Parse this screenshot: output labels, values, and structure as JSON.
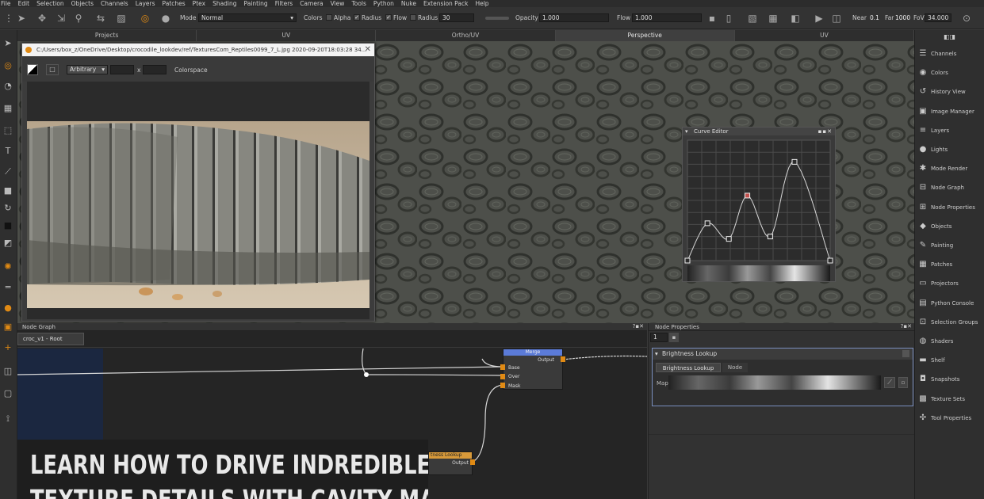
{
  "menu": [
    "File",
    "Edit",
    "Selection",
    "Objects",
    "Channels",
    "Layers",
    "Patches",
    "Ptex",
    "Shading",
    "Painting",
    "Filters",
    "Camera",
    "View",
    "Tools",
    "Python",
    "Nuke",
    "Extension Pack",
    "Help"
  ],
  "toolbar": {
    "mode_label": "Mode",
    "mode_value": "Normal",
    "colors_label": "Colors",
    "alpha_label": "Alpha",
    "radius_label": "Radius",
    "flow_label": "Flow",
    "radius2_label": "Radius",
    "radius_value": "30",
    "opacity_label": "Opacity",
    "opacity_value": "1.000",
    "flow2_label": "Flow",
    "flow_value": "1.000",
    "near_label": "Near",
    "near_value": "0.1",
    "far_label": "Far",
    "far_value": "1000",
    "fov_label": "FoV",
    "fov_value": "34.000"
  },
  "tabs": [
    {
      "label": "Projects",
      "active": false
    },
    {
      "label": "UV",
      "active": false
    },
    {
      "label": "Ortho/UV",
      "active": false
    },
    {
      "label": "Perspective",
      "active": true
    },
    {
      "label": "UV",
      "active": false
    }
  ],
  "image_window": {
    "title": "C:/Users/box_z/OneDrive/Desktop/crocodile_lookdev/ref/TexturesCom_Reptiles0099_7_L.jpg 2020-09-20T18:03:28 34...",
    "size_mode": "Arbitrary",
    "x_sep": "x",
    "colorspace_label": "Colorspace"
  },
  "curve_editor": {
    "title": "Curve Editor",
    "points": [
      [
        0,
        0
      ],
      [
        0.14,
        0.31
      ],
      [
        0.29,
        0.18
      ],
      [
        0.42,
        0.54
      ],
      [
        0.58,
        0.2
      ],
      [
        0.75,
        0.82
      ],
      [
        1,
        0
      ]
    ],
    "active_point_index": 3
  },
  "node_graph": {
    "panel_title": "Node Graph",
    "breadcrumb": "croc_v1 - Root",
    "merge_node": {
      "title": "Merge",
      "output": "Output",
      "inputs": [
        "Base",
        "Over",
        "Mask"
      ]
    },
    "lookup_node": {
      "title": "tness Lookup",
      "output": "Output"
    }
  },
  "node_properties": {
    "panel_title": "Node Properties",
    "counter": "1",
    "section_title": "Brightness Lookup",
    "tabs": [
      "Brightness Lookup",
      "Node"
    ],
    "map_label": "Map"
  },
  "right_panel": [
    {
      "label": "Channels",
      "icon": "channels-icon",
      "glyph": "☰"
    },
    {
      "label": "Colors",
      "icon": "palette-icon",
      "glyph": "◉"
    },
    {
      "label": "History View",
      "icon": "history-icon",
      "glyph": "↺"
    },
    {
      "label": "Image Manager",
      "icon": "image-icon",
      "glyph": "▣"
    },
    {
      "label": "Layers",
      "icon": "layers-icon",
      "glyph": "≡"
    },
    {
      "label": "Lights",
      "icon": "bulb-icon",
      "glyph": "●"
    },
    {
      "label": "Mode Render",
      "icon": "render-icon",
      "glyph": "✱"
    },
    {
      "label": "Node Graph",
      "icon": "node-graph-icon",
      "glyph": "⊟"
    },
    {
      "label": "Node Properties",
      "icon": "node-props-icon",
      "glyph": "⊞"
    },
    {
      "label": "Objects",
      "icon": "objects-icon",
      "glyph": "◆"
    },
    {
      "label": "Painting",
      "icon": "brush-icon",
      "glyph": "✎"
    },
    {
      "label": "Patches",
      "icon": "patches-icon",
      "glyph": "▦"
    },
    {
      "label": "Projectors",
      "icon": "projector-icon",
      "glyph": "▭"
    },
    {
      "label": "Python Console",
      "icon": "console-icon",
      "glyph": "▤"
    },
    {
      "label": "Selection Groups",
      "icon": "selection-icon",
      "glyph": "⊡"
    },
    {
      "label": "Shaders",
      "icon": "shaders-icon",
      "glyph": "◍"
    },
    {
      "label": "Shelf",
      "icon": "shelf-icon",
      "glyph": "▬"
    },
    {
      "label": "Snapshots",
      "icon": "camera-icon",
      "glyph": "◘"
    },
    {
      "label": "Texture Sets",
      "icon": "texture-sets-icon",
      "glyph": "▩"
    },
    {
      "label": "Tool Properties",
      "icon": "wrench-icon",
      "glyph": "✣"
    }
  ],
  "banner": {
    "line1": "LEARN HOW TO DRIVE INDREDIBLE",
    "line2": "TEXTURE DETAILS WITH CAVITY MAP"
  },
  "colors": {
    "accent": "#e08a14",
    "node_header": "#5b7bd8",
    "selected_border": "#7a8fbf"
  }
}
